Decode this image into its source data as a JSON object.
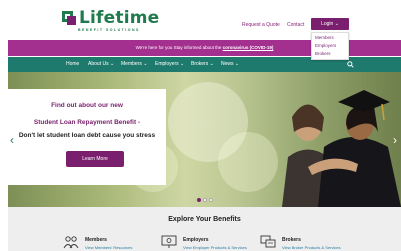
{
  "header": {
    "logo_name": "Lifetime",
    "logo_tagline": "BENEFIT SOLUTIONS",
    "links": [
      {
        "label": "Request a Quote"
      },
      {
        "label": "Contact"
      }
    ],
    "login_label": "Login",
    "login_menu": [
      "Members",
      "Employers",
      "Brokers"
    ]
  },
  "announcement": {
    "text": "We're here for you Stay informed about the",
    "link": "coronavirus (COVID-19)"
  },
  "nav": {
    "items": [
      "Home",
      "About Us",
      "Members",
      "Employers",
      "Brokers",
      "News"
    ]
  },
  "hero": {
    "line1": "Find out about our new",
    "line2": "Student Loan Repayment Benefit -",
    "line3": "Don't let student loan debt cause you stress",
    "button": "Learn More"
  },
  "explore": {
    "title": "Explore Your Benefits",
    "items": [
      {
        "title": "Members",
        "link": "View Members' Resources"
      },
      {
        "title": "Employers",
        "link": "View Employer Products & Services"
      },
      {
        "title": "Brokers",
        "link": "View Broker Products & Services"
      }
    ]
  },
  "colors": {
    "brand_purple": "#7a1f6e",
    "brand_green": "#1f7a4d",
    "nav_teal": "#1f7a6e",
    "announce_magenta": "#a3308f"
  },
  "icons": [
    "search-icon",
    "chevron-left-icon",
    "chevron-right-icon",
    "people-icon",
    "presentation-icon",
    "broker-icon"
  ]
}
